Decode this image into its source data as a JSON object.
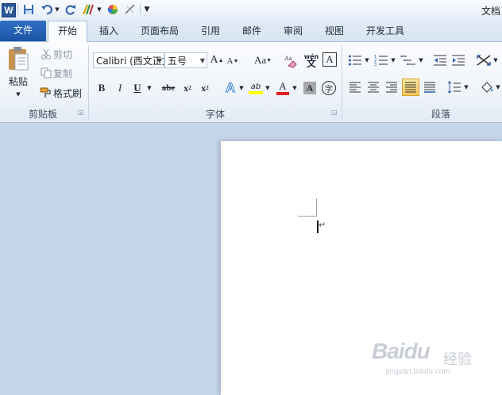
{
  "app": {
    "logo_letter": "W",
    "doc_title": "文档"
  },
  "quick_access": {
    "icons": [
      "save-icon",
      "undo-icon",
      "redo-icon",
      "format-painter-icon",
      "color-icon",
      "draw-icon",
      "customize-icon"
    ]
  },
  "tabs": {
    "file": "文件",
    "items": [
      "开始",
      "插入",
      "页面布局",
      "引用",
      "邮件",
      "审阅",
      "视图",
      "开发工具"
    ],
    "active": "开始"
  },
  "clipboard": {
    "paste": "粘贴",
    "cut": "剪切",
    "copy": "复制",
    "format_painter": "格式刷",
    "label": "剪贴板"
  },
  "font": {
    "font_name": "Calibri (西文正文)",
    "font_size": "五号",
    "grow": "A",
    "shrink": "A",
    "change_case": "Aa",
    "clear": "Aa",
    "phonetic": "wén",
    "phonetic_char": "文",
    "border_char": "A",
    "bold": "B",
    "italic": "I",
    "underline": "U",
    "strike": "abe",
    "subscript": "x",
    "superscript": "x",
    "text_effect": "A",
    "highlight": "ab",
    "font_color": "A",
    "char_shading": "A",
    "enclose": "字",
    "label": "字体",
    "colors": {
      "highlight": "#ffff00",
      "font_color": "#e02020"
    }
  },
  "paragraph": {
    "label": "段落"
  },
  "document": {
    "paragraph_mark": "↵"
  },
  "watermark": {
    "brand": "Baidu",
    "cn": "经验",
    "url": "jingyan.baidu.com"
  },
  "colors": {
    "file_tab": "#1d55a5",
    "ribbon_bg": "#eef3f9",
    "workspace": "#c5d6ea",
    "active_align": "#f7c95a"
  }
}
